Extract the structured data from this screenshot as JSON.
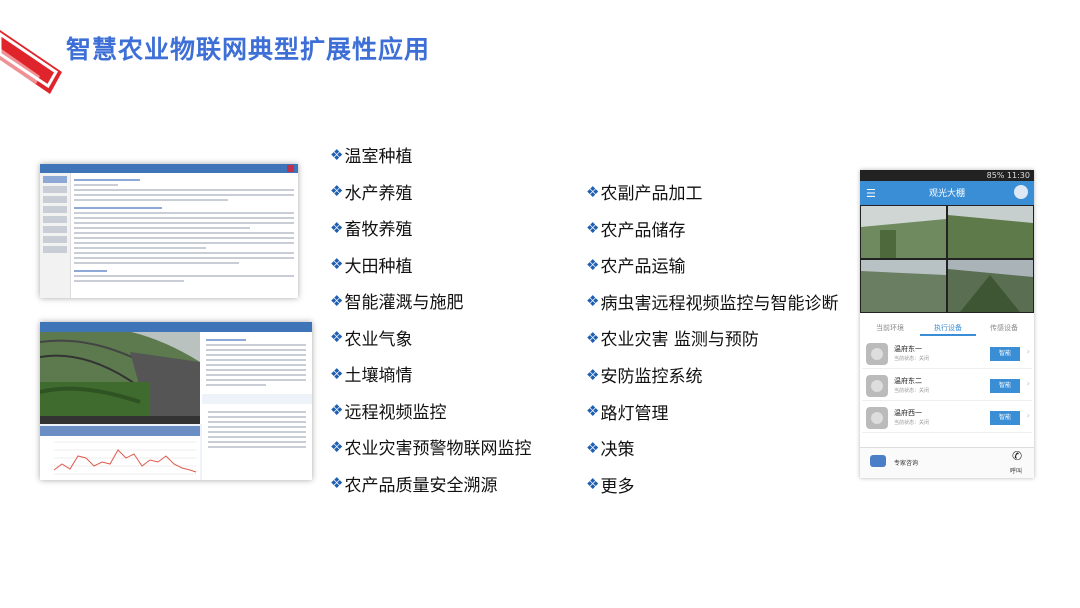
{
  "title": "智慧农业物联网典型扩展性应用",
  "bullet_symbol": "❖",
  "left_list": [
    "温室种植",
    "水产养殖",
    "畜牧养殖",
    "大田种植",
    "智能灌溉与施肥",
    "农业气象",
    "土壤墒情",
    "远程视频监控",
    "农业灾害预警物联网监控",
    "农产品质量安全溯源"
  ],
  "right_list": [
    "农副产品加工",
    "农产品储存",
    "农产品运输",
    "病虫害远程视频监控与智能诊断",
    "农业灾害 监测与预防",
    "安防监控系统",
    "路灯管理",
    "决策",
    "更多"
  ],
  "phone": {
    "status_text": "85%  11:30",
    "app_title": "观光大棚",
    "tabs": [
      "当前环境",
      "执行设备",
      "传感设备"
    ],
    "active_tab": 1,
    "devices": [
      {
        "name": "温府东一",
        "status": "当前状态：关闭",
        "button": "智能"
      },
      {
        "name": "温府东二",
        "status": "当前状态：关闭",
        "button": "智能"
      },
      {
        "name": "温府西一",
        "status": "当前状态：关闭",
        "button": "智能"
      }
    ],
    "footer_left": "专家咨询",
    "footer_right": "呼叫"
  },
  "colors": {
    "title": "#3d6fd6",
    "bullet": "#1f5fb3",
    "accent_red": "#e0242b",
    "app_blue": "#3a8ed6"
  }
}
